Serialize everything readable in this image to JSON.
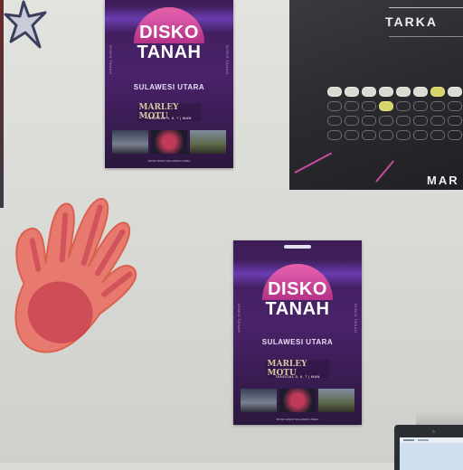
{
  "scene": {
    "wall_color": "#dcddd9"
  },
  "poster_top": {
    "title_line1": "DISKO",
    "title_line2": "TANAH",
    "subtitle": "SULAWESI UTARA",
    "side_text": "DISKO TANAH",
    "performer": "MARLEY MOTU",
    "date": "TANGGAL 5, 6, 7 | MAN",
    "footer": "MUSIK DISKO SULAWESI UTARA",
    "accent": "#4a226a"
  },
  "poster_bottom": {
    "title_line1": "DISKO",
    "title_line2": "TANAH",
    "subtitle": "SULAWESI UTARA",
    "side_text": "DISKO TANAH",
    "performer": "MARLEY MOTU",
    "date": "TANGGAL 5, 6, 7 | MAN",
    "footer": "MUSIK DISKO SULAWESI UTARA",
    "accent": "#4a226a"
  },
  "poster_dark": {
    "title": "TARKA",
    "footer": "MAR",
    "accent": "#c64ca0"
  },
  "decorations": {
    "star": "star-sticker-icon",
    "hand": "hand-print-icon",
    "hand_color": "#e8796f"
  },
  "laptop": {
    "icon": "laptop-icon"
  }
}
